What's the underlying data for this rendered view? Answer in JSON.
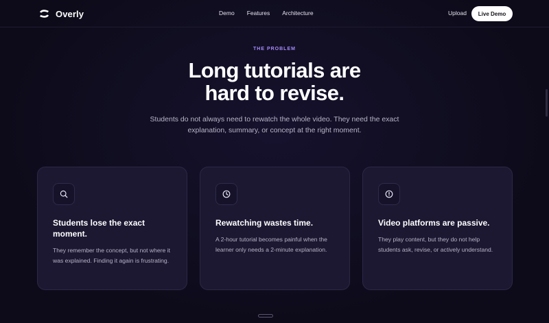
{
  "nav": {
    "brand": "Overly",
    "links": [
      "Demo",
      "Features",
      "Architecture"
    ],
    "upload": "Upload",
    "cta": "Live Demo"
  },
  "hero": {
    "eyebrow": "THE PROBLEM",
    "headline": [
      "Long tutorials are",
      "hard to revise."
    ],
    "subtitle": [
      "Students do not always need to rewatch the whole video. They need the exact",
      "explanation, summary, or concept at the right moment."
    ]
  },
  "cards": [
    {
      "icon": "search-icon",
      "title": "Students lose the exact moment.",
      "body": "They remember the concept, but not where it was explained. Finding it again is frustrating."
    },
    {
      "icon": "clock-icon",
      "title": "Rewatching wastes time.",
      "body": "A 2-hour tutorial becomes painful when the learner only needs a 2-minute explanation."
    },
    {
      "icon": "alert-circle-icon",
      "title": "Video platforms are passive.",
      "body": "They play content, but they do not help students ask, revise, or actively understand."
    }
  ],
  "colors": {
    "background": "#0d0b1a",
    "card": "#1c1832",
    "accent": "#a78bfa",
    "text": "#ffffff",
    "muted": "#b6b3c6"
  }
}
